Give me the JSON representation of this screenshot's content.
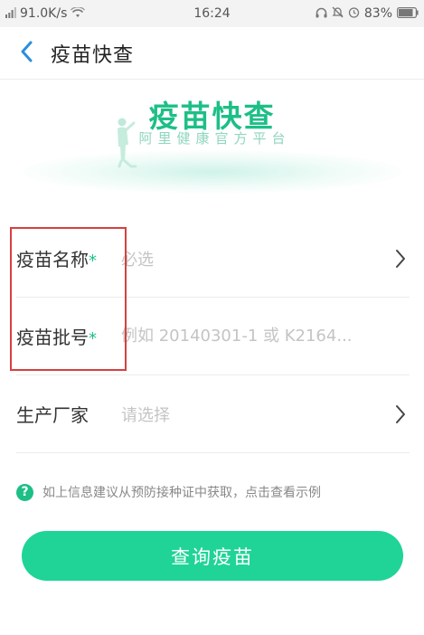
{
  "status_bar": {
    "network_speed": "91.0K/s",
    "time": "16:24",
    "battery": "83%"
  },
  "nav": {
    "title": "疫苗快查"
  },
  "hero": {
    "title": "疫苗快查",
    "subtitle": "阿里健康官方平台"
  },
  "form": {
    "rows": [
      {
        "label": "疫苗名称",
        "required_mark": "*",
        "placeholder": "必选",
        "has_chevron": true
      },
      {
        "label": "疫苗批号",
        "required_mark": "*",
        "placeholder": "例如 20140301-1 或 K2164...",
        "has_chevron": false
      },
      {
        "label": "生产厂家",
        "required_mark": "",
        "placeholder": "请选择",
        "has_chevron": true
      }
    ]
  },
  "hint": {
    "icon": "question-icon",
    "icon_glyph": "?",
    "text": "如上信息建议从预防接种证中获取，点击查看示例"
  },
  "query_button": {
    "label": "查询疫苗"
  },
  "colors": {
    "accent": "#1dbf86",
    "button": "#1fd496",
    "highlight": "#d64040",
    "back_arrow": "#2a8ee0"
  }
}
